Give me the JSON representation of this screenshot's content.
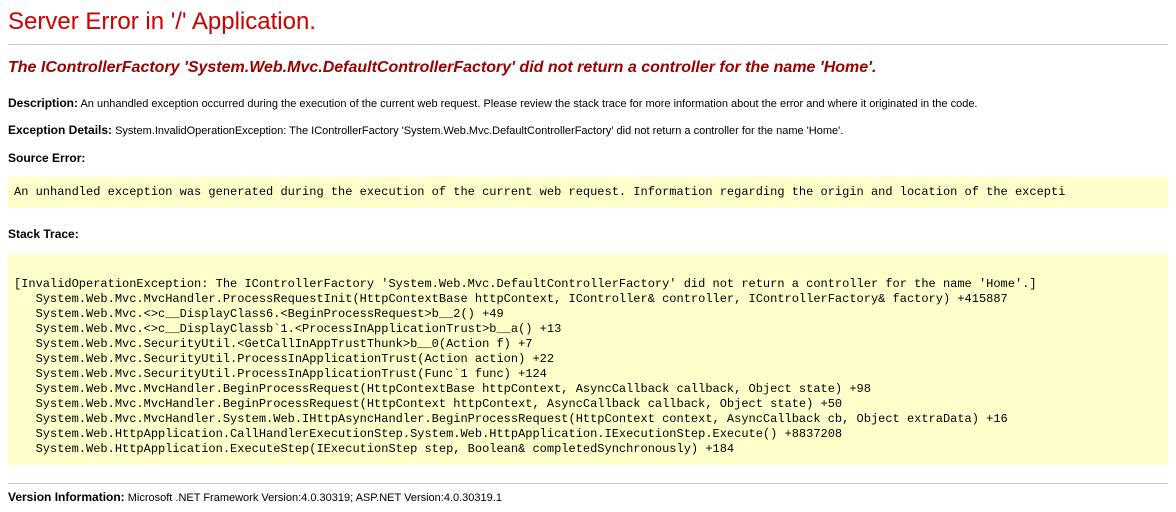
{
  "title": "Server Error in '/' Application.",
  "exception_message": "The IControllerFactory 'System.Web.Mvc.DefaultControllerFactory' did not return a controller for the name 'Home'.",
  "description": {
    "label": "Description:",
    "text": "An unhandled exception occurred during the execution of the current web request. Please review the stack trace for more information about the error and where it originated in the code."
  },
  "exception_details": {
    "label": "Exception Details:",
    "text": "System.InvalidOperationException: The IControllerFactory 'System.Web.Mvc.DefaultControllerFactory' did not return a controller for the name 'Home'."
  },
  "source_error": {
    "label": "Source Error:",
    "text": "An unhandled exception was generated during the execution of the current web request. Information regarding the origin and location of the excepti"
  },
  "stack_trace": {
    "label": "Stack Trace:",
    "text": "\n[InvalidOperationException: The IControllerFactory 'System.Web.Mvc.DefaultControllerFactory' did not return a controller for the name 'Home'.]\n   System.Web.Mvc.MvcHandler.ProcessRequestInit(HttpContextBase httpContext, IController& controller, IControllerFactory& factory) +415887\n   System.Web.Mvc.<>c__DisplayClass6.<BeginProcessRequest>b__2() +49\n   System.Web.Mvc.<>c__DisplayClassb`1.<ProcessInApplicationTrust>b__a() +13\n   System.Web.Mvc.SecurityUtil.<GetCallInAppTrustThunk>b__0(Action f) +7\n   System.Web.Mvc.SecurityUtil.ProcessInApplicationTrust(Action action) +22\n   System.Web.Mvc.SecurityUtil.ProcessInApplicationTrust(Func`1 func) +124\n   System.Web.Mvc.MvcHandler.BeginProcessRequest(HttpContextBase httpContext, AsyncCallback callback, Object state) +98\n   System.Web.Mvc.MvcHandler.BeginProcessRequest(HttpContext httpContext, AsyncCallback callback, Object state) +50\n   System.Web.Mvc.MvcHandler.System.Web.IHttpAsyncHandler.BeginProcessRequest(HttpContext context, AsyncCallback cb, Object extraData) +16\n   System.Web.HttpApplication.CallHandlerExecutionStep.System.Web.HttpApplication.IExecutionStep.Execute() +8837208\n   System.Web.HttpApplication.ExecuteStep(IExecutionStep step, Boolean& completedSynchronously) +184\n"
  },
  "version": {
    "label": "Version Information:",
    "text": "Microsoft .NET Framework Version:4.0.30319; ASP.NET Version:4.0.30319.1"
  }
}
